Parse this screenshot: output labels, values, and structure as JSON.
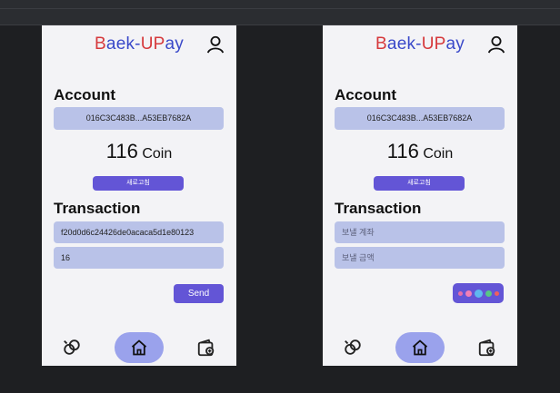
{
  "app": {
    "logo_parts": [
      "B",
      "aek-",
      "UP",
      "ay"
    ],
    "colors": {
      "accent": "#6355d6",
      "field": "#b9c2e8",
      "logo_red": "#d6383b",
      "logo_blue": "#3a49c9",
      "home_pill": "#9aa2ec"
    }
  },
  "screens": [
    {
      "account_heading": "Account",
      "account_id": "016C3C483B...A53EB7682A",
      "balance_value": "116",
      "balance_unit": "Coin",
      "refresh_label": "새로고침",
      "transaction_heading": "Transaction",
      "recipient_value": "f20d0d6c24426de0acaca5d1e80123",
      "recipient_placeholder": "보낼 계좌",
      "amount_value": "16",
      "amount_placeholder": "보낼 금액",
      "send_label": "Send"
    },
    {
      "account_heading": "Account",
      "account_id": "016C3C483B...A53EB7682A",
      "balance_value": "116",
      "balance_unit": "Coin",
      "refresh_label": "새로고침",
      "transaction_heading": "Transaction",
      "recipient_value": "",
      "recipient_placeholder": "보낼 계좌",
      "amount_value": "",
      "amount_placeholder": "보낼 금액",
      "loading_dots": [
        "#e86fa8",
        "#f27fb7",
        "#5fb8ef",
        "#58c785",
        "#ef5f5f"
      ]
    }
  ],
  "nav": {
    "left_icon": "coin-link-icon",
    "center_icon": "home-icon",
    "right_icon": "wallet-add-icon"
  }
}
